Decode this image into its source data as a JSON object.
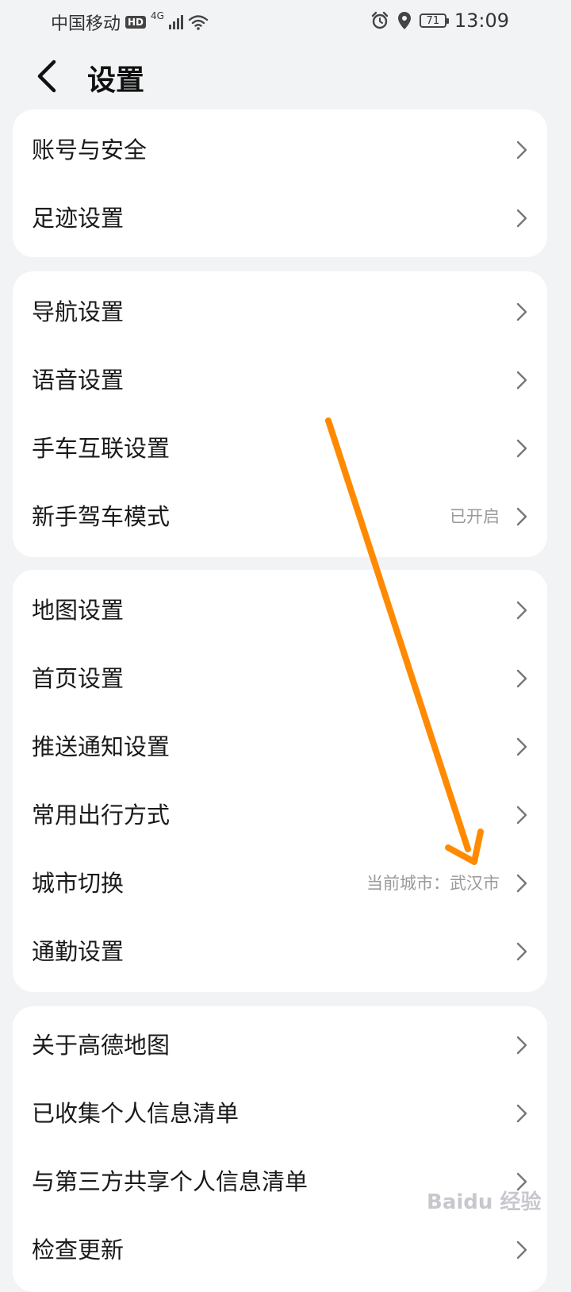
{
  "status_bar": {
    "carrier": "中国移动",
    "hd_badge": "HD",
    "network": "4G",
    "battery": "71",
    "time": "13:09"
  },
  "header": {
    "title": "设置",
    "back_icon": "chevron-left-icon"
  },
  "sections": [
    {
      "items": [
        {
          "label": "账号与安全",
          "value": ""
        },
        {
          "label": "足迹设置",
          "value": ""
        }
      ]
    },
    {
      "items": [
        {
          "label": "导航设置",
          "value": ""
        },
        {
          "label": "语音设置",
          "value": ""
        },
        {
          "label": "手车互联设置",
          "value": ""
        },
        {
          "label": "新手驾车模式",
          "value": "已开启"
        }
      ]
    },
    {
      "items": [
        {
          "label": "地图设置",
          "value": ""
        },
        {
          "label": "首页设置",
          "value": ""
        },
        {
          "label": "推送通知设置",
          "value": ""
        },
        {
          "label": "常用出行方式",
          "value": ""
        },
        {
          "label": "城市切换",
          "value": "当前城市：武汉市"
        },
        {
          "label": "通勤设置",
          "value": ""
        }
      ]
    },
    {
      "items": [
        {
          "label": "关于高德地图",
          "value": ""
        },
        {
          "label": "已收集个人信息清单",
          "value": ""
        },
        {
          "label": "与第三方共享个人信息清单",
          "value": ""
        },
        {
          "label": "检查更新",
          "value": ""
        }
      ]
    }
  ],
  "annotation": {
    "arrow_color": "#ff8a00"
  },
  "watermark": "Baidu 经验"
}
